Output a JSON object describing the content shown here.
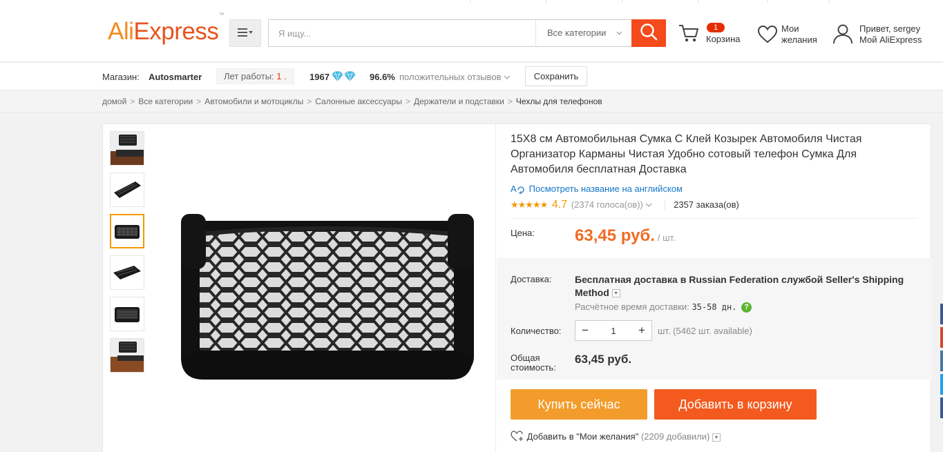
{
  "header": {
    "logo_text_a": "Ali",
    "logo_text_b": "Express",
    "logo_tm": "™",
    "search": {
      "placeholder": "Я ищу...",
      "category": "Все категории"
    },
    "cart": {
      "count": "1",
      "label": "Корзина"
    },
    "wishlist": {
      "line1": "Мои",
      "line2": "желания"
    },
    "account": {
      "greeting": "Привет, sergey",
      "label": "Мой AliExpress"
    }
  },
  "store": {
    "label": "Магазин:",
    "name": "Autosmarter",
    "years_label": "Лет работы:",
    "years_value": "1 .",
    "feedback_score": "1967",
    "positive_pct": "96.6%",
    "positive_label": "положительных отзывов",
    "save_label": "Сохранить"
  },
  "breadcrumb": [
    "домой",
    "Все категории",
    "Автомобили и мотоциклы",
    "Салонные аксессуары",
    "Держатели и подставки",
    "Чехлы для телефонов"
  ],
  "product": {
    "title": "15X8 см Автомобильная Сумка С Клей Козырек Автомобиля Чистая Организатор Карманы Чистая Удобно сотовый телефон Сумка Для Автомобиля бесплатная Доставка",
    "translate_label": "Посмотреть название на английском",
    "rating": "4.7",
    "votes": "(2374 голоса(ов))",
    "orders": "2357 заказа(ов)",
    "price_label": "Цена:",
    "price": "63,45 руб.",
    "price_unit": "/ шт.",
    "shipping_label": "Доставка:",
    "shipping_prefix": "Бесплатная доставка в ",
    "shipping_country": "Russian Federation",
    "shipping_middle": " службой ",
    "shipping_method": "Seller's Shipping Method",
    "eta_label": "Расчётное время доставки:",
    "eta_days": "35-58 дн.",
    "quantity_label": "Количество:",
    "quantity_value": "1",
    "quantity_available": "шт. (5462 шт. available)",
    "total_label": "Общая стоимость:",
    "total_value": "63,45 руб.",
    "buy_now": "Купить сейчас",
    "add_to_cart": "Добавить в корзину",
    "wishlist_label": "Добавить в \"Мои желания\"",
    "wishlist_count": "(2209 добавили)"
  },
  "colors": {
    "accent_orange": "#f26b22",
    "buy_button": "#f39c2b",
    "cart_button": "#f45a1e",
    "search_button": "#f34b1b",
    "link_blue": "#1476c7"
  }
}
